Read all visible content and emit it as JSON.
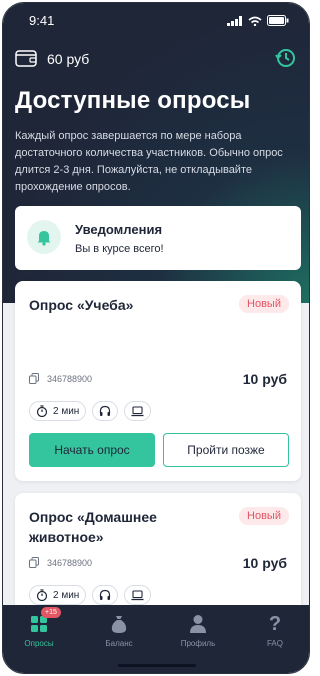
{
  "status": {
    "time": "9:41"
  },
  "header": {
    "balance": "60 руб",
    "title": "Доступные опросы",
    "description": "Каждый опрос завершается по мере набора достаточного количества участников. Обычно опрос длится 2-3 дня. Пожалуйста, не откладывайте прохождение опросов."
  },
  "notification": {
    "title": "Уведомления",
    "subtitle": "Вы в курсе всего!"
  },
  "surveys": [
    {
      "title": "Опрос «Учеба»",
      "badge": "Новый",
      "id": "346788900",
      "price": "10 руб",
      "duration": "2 мин",
      "start_label": "Начать опрос",
      "later_label": "Пройти позже"
    },
    {
      "title": "Опрос «Домашнее животное»",
      "badge": "Новый",
      "id": "346788900",
      "price": "10 руб",
      "duration": "2 мин"
    }
  ],
  "tabs": [
    {
      "label": "Опросы",
      "icon": "grid-icon",
      "active": true,
      "counter": "+15"
    },
    {
      "label": "Баланс",
      "icon": "money-bag-icon"
    },
    {
      "label": "Профиль",
      "icon": "person-icon"
    },
    {
      "label": "FAQ",
      "icon": "question-icon"
    }
  ],
  "colors": {
    "accent": "#34c49e",
    "dark": "#1f2638",
    "badge": "#e25563"
  }
}
